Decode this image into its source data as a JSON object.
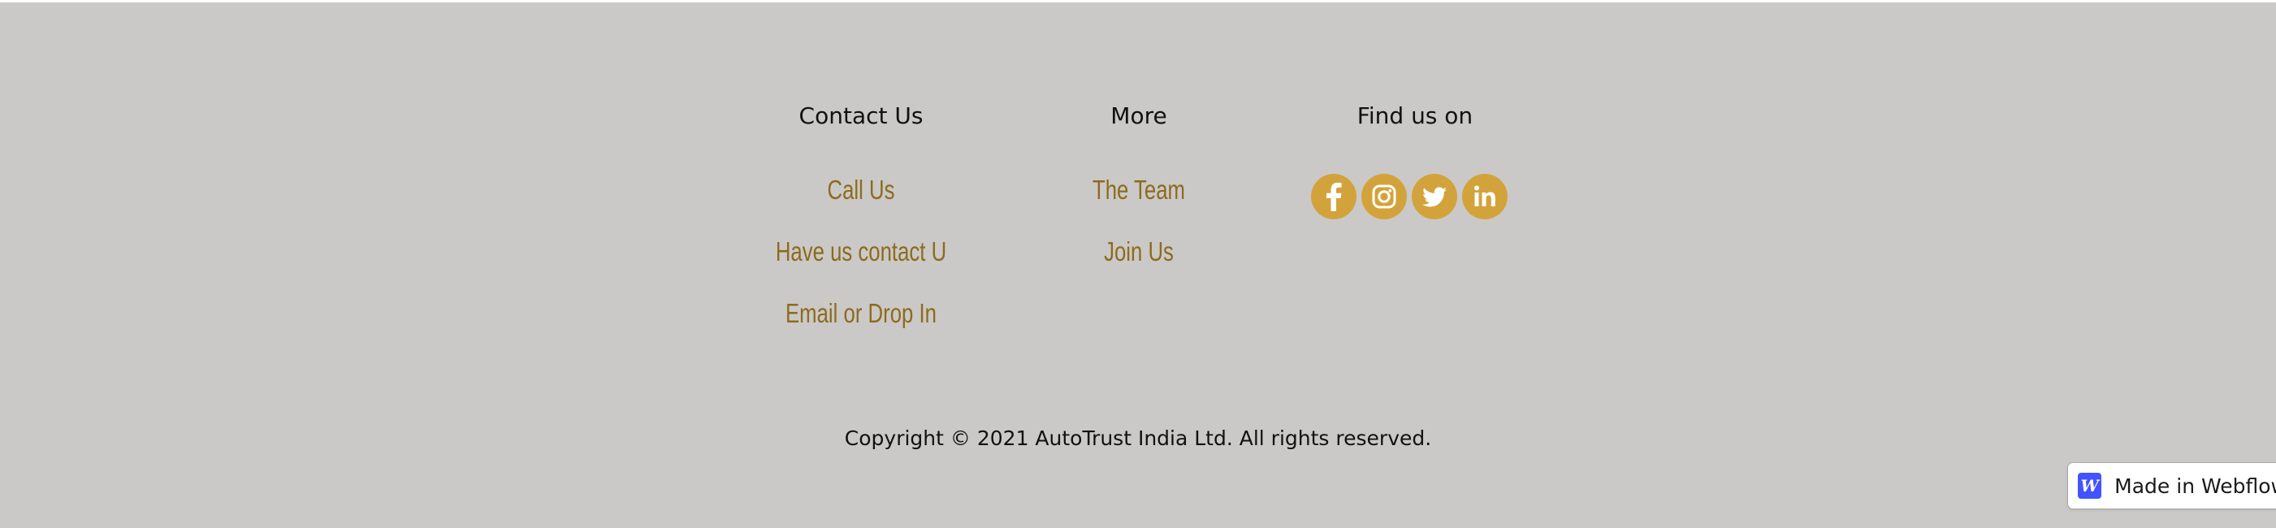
{
  "footer": {
    "contact": {
      "heading": "Contact Us",
      "links": [
        "Call Us",
        "Have us contact U",
        "Email or Drop In"
      ]
    },
    "more": {
      "heading": "More",
      "links": [
        "The Team",
        "Join Us"
      ]
    },
    "social": {
      "heading": "Find us on",
      "icons": [
        "facebook-icon",
        "instagram-icon",
        "twitter-icon",
        "linkedin-icon"
      ]
    },
    "copyright": "Copyright © 2021 AutoTrust India Ltd. All rights reserved."
  },
  "badge": {
    "logo_letter": "W",
    "label": "Made in Webflow"
  },
  "colors": {
    "background": "#cac9c7",
    "link": "#8d6b1d",
    "icon_circle": "#d3a33b",
    "webflow_blue": "#4353ff"
  }
}
